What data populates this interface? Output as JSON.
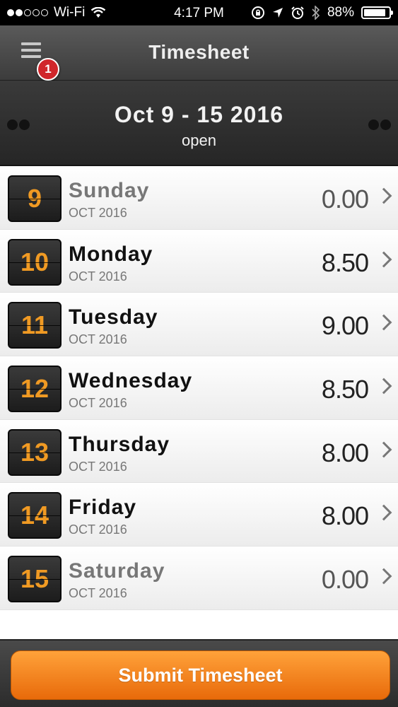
{
  "status_bar": {
    "carrier": "Wi-Fi",
    "time": "4:17 PM",
    "battery": "88%",
    "battery_level": 0.88
  },
  "navbar": {
    "title": "Timesheet",
    "badge_count": "1"
  },
  "week": {
    "range": "Oct 9 - 15 2016",
    "status": "open"
  },
  "days": [
    {
      "num": "9",
      "name": "Sunday",
      "sub": "OCT 2016",
      "hours": "0.00",
      "weekend": true
    },
    {
      "num": "10",
      "name": "Monday",
      "sub": "OCT 2016",
      "hours": "8.50",
      "weekend": false
    },
    {
      "num": "11",
      "name": "Tuesday",
      "sub": "OCT 2016",
      "hours": "9.00",
      "weekend": false
    },
    {
      "num": "12",
      "name": "Wednesday",
      "sub": "OCT 2016",
      "hours": "8.50",
      "weekend": false
    },
    {
      "num": "13",
      "name": "Thursday",
      "sub": "OCT 2016",
      "hours": "8.00",
      "weekend": false
    },
    {
      "num": "14",
      "name": "Friday",
      "sub": "OCT 2016",
      "hours": "8.00",
      "weekend": false
    },
    {
      "num": "15",
      "name": "Saturday",
      "sub": "OCT 2016",
      "hours": "0.00",
      "weekend": true
    }
  ],
  "footer": {
    "submit_label": "Submit Timesheet"
  },
  "colors": {
    "accent": "#f09a23",
    "button": "#f5821f",
    "badge": "#d0262b"
  }
}
